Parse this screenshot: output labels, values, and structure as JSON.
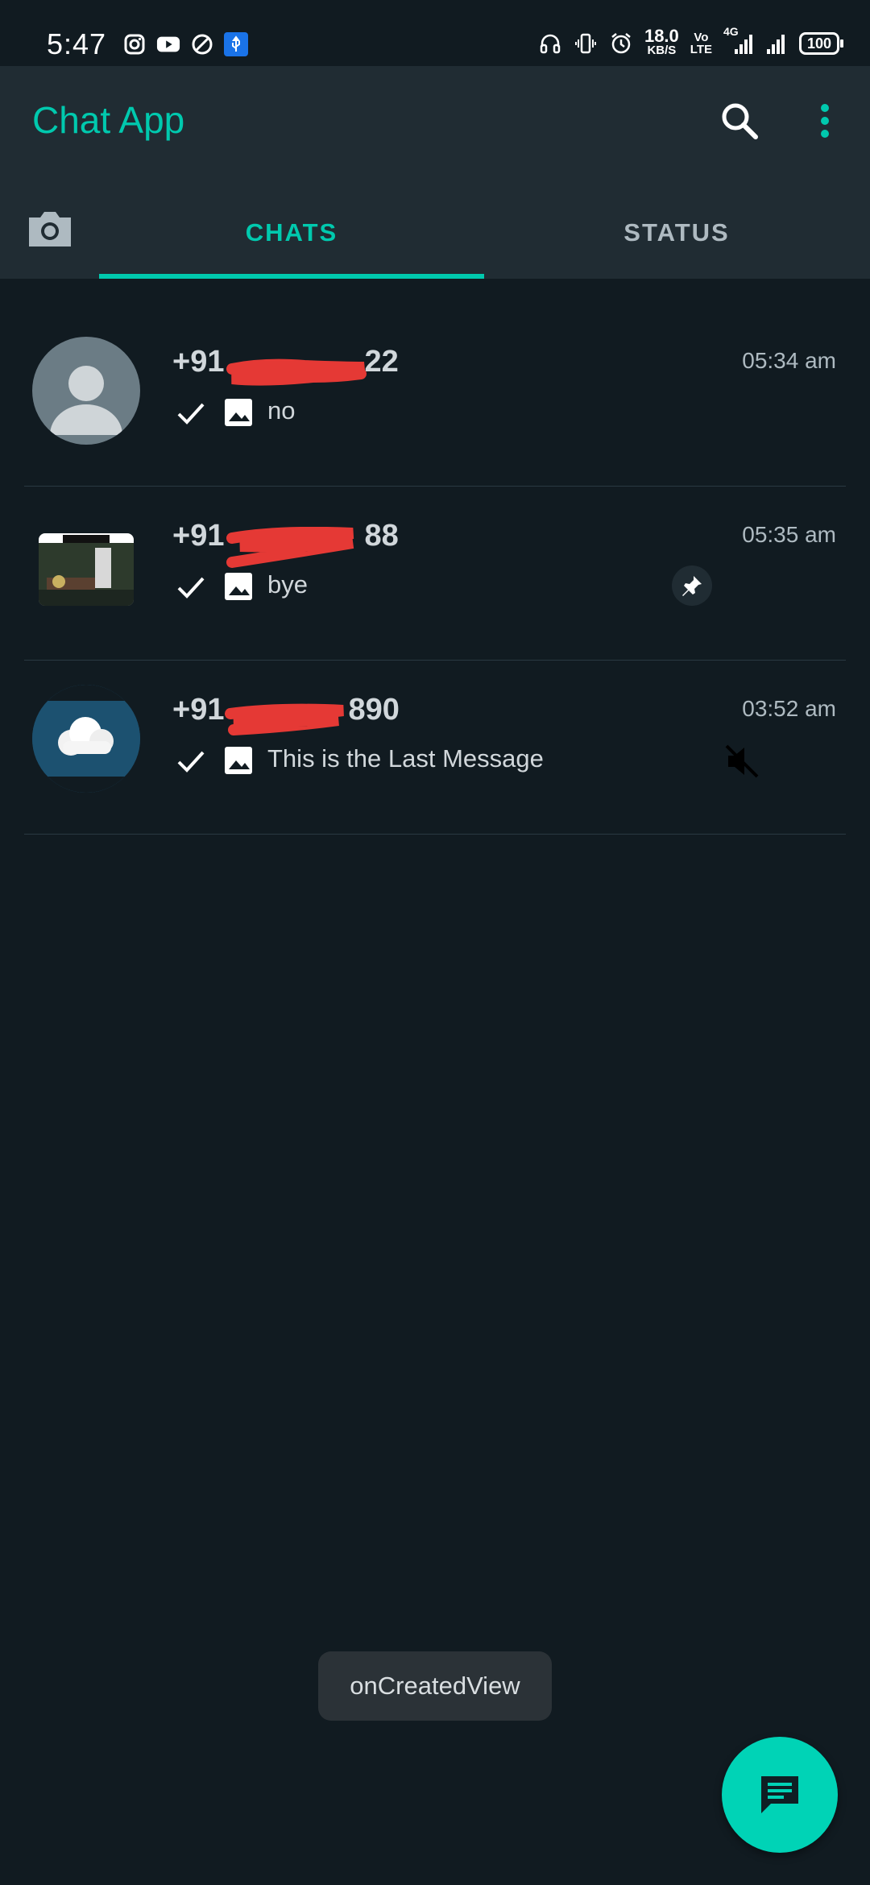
{
  "status_bar": {
    "time": "5:47",
    "speed_value": "18.0",
    "speed_unit": "KB/S",
    "volte_top": "Vo",
    "volte_bottom": "LTE",
    "network": "4G",
    "battery": "100",
    "left_icons": [
      "instagram-icon",
      "youtube-icon",
      "blocked-icon",
      "usb-icon"
    ],
    "right_icons": [
      "headphones-icon",
      "vibrate-icon",
      "alarm-icon",
      "signal-icon"
    ]
  },
  "header": {
    "title": "Chat App",
    "accent_color": "#00c9ae"
  },
  "tabs": {
    "camera_icon": "camera-icon",
    "items": [
      {
        "label": "CHATS",
        "active": true
      },
      {
        "label": "STATUS",
        "active": false
      }
    ]
  },
  "chats": [
    {
      "name_prefix": "+91",
      "name_suffix": "22",
      "time": "05:34 am",
      "message": "no",
      "avatar": "default-avatar",
      "pinned": false,
      "muted": false
    },
    {
      "name_prefix": "+91",
      "name_suffix": "88",
      "time": "05:35 am",
      "message": "bye",
      "avatar": "photo-avatar",
      "pinned": true,
      "muted": false
    },
    {
      "name_prefix": "+91",
      "name_suffix": "890",
      "time": "03:52 am",
      "message": "This is the Last Message",
      "avatar": "cloud-avatar",
      "pinned": false,
      "muted": true
    }
  ],
  "toast": {
    "text": "onCreatedView"
  },
  "fab": {
    "icon": "new-chat-icon"
  }
}
